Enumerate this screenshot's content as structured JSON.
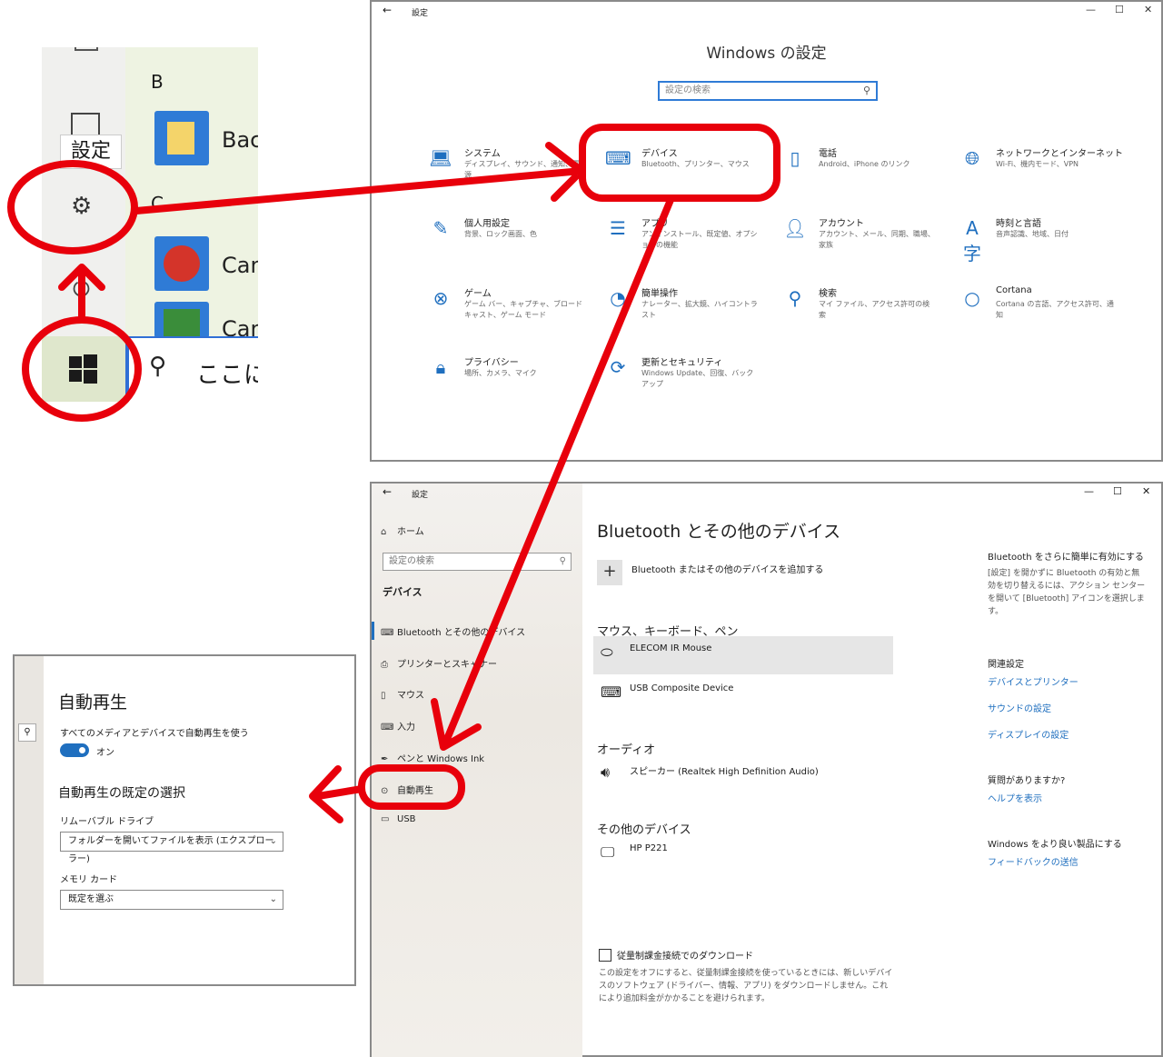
{
  "start_menu": {
    "letter_b": "B",
    "letter_c": "C",
    "tooltip": "設定",
    "apps": [
      "Bacl",
      "Can",
      "Can"
    ],
    "search_text": "ここに入"
  },
  "home_window": {
    "title_bar": "設定",
    "back": "←",
    "controls": [
      "—",
      "☐",
      "✕"
    ],
    "heading": "Windows の設定",
    "search_placeholder": "設定の検索",
    "categories": [
      {
        "name": "システム",
        "desc": "ディスプレイ、サウンド、通知、電源",
        "icon": "laptop-icon"
      },
      {
        "name": "デバイス",
        "desc": "Bluetooth、プリンター、マウス",
        "icon": "keyboard-speaker-icon"
      },
      {
        "name": "電話",
        "desc": "Android、iPhone のリンク",
        "icon": "phone-icon"
      },
      {
        "name": "ネットワークとインターネット",
        "desc": "Wi-Fi、機内モード、VPN",
        "icon": "globe-icon"
      },
      {
        "name": "個人用設定",
        "desc": "背景、ロック画面、色",
        "icon": "paint-icon"
      },
      {
        "name": "アプリ",
        "desc": "アンインストール、既定値、オプションの機能",
        "icon": "apps-list-icon"
      },
      {
        "name": "アカウント",
        "desc": "アカウント、メール、同期、職場、家族",
        "icon": "person-icon"
      },
      {
        "name": "時刻と言語",
        "desc": "音声認識、地域、日付",
        "icon": "time-language-icon"
      },
      {
        "name": "ゲーム",
        "desc": "ゲーム バー、キャプチャ、ブロードキャスト、ゲーム モード",
        "icon": "xbox-icon"
      },
      {
        "name": "簡単操作",
        "desc": "ナレーター、拡大鏡、ハイコントラスト",
        "icon": "ease-of-access-icon"
      },
      {
        "name": "検索",
        "desc": "マイ ファイル、アクセス許可の検索",
        "icon": "search-icon"
      },
      {
        "name": "Cortana",
        "desc": "Cortana の言語、アクセス許可、通知",
        "icon": "cortana-icon"
      },
      {
        "name": "プライバシー",
        "desc": "場所、カメラ、マイク",
        "icon": "lock-icon"
      },
      {
        "name": "更新とセキュリティ",
        "desc": "Windows Update、回復、バックアップ",
        "icon": "refresh-icon"
      }
    ]
  },
  "devices_window": {
    "title_bar": "設定",
    "back": "←",
    "controls": [
      "—",
      "☐",
      "✕"
    ],
    "sidebar": {
      "home": "ホーム",
      "search_placeholder": "設定の検索",
      "section": "デバイス",
      "items": [
        {
          "label": "Bluetooth とその他のデバイス",
          "icon": "bluetooth-devices-icon"
        },
        {
          "label": "プリンターとスキャナー",
          "icon": "printer-icon"
        },
        {
          "label": "マウス",
          "icon": "mouse-icon"
        },
        {
          "label": "入力",
          "icon": "keyboard-icon"
        },
        {
          "label": "ペンと Windows Ink",
          "icon": "pen-icon"
        },
        {
          "label": "自動再生",
          "icon": "autoplay-icon"
        },
        {
          "label": "USB",
          "icon": "usb-icon"
        }
      ]
    },
    "main": {
      "heading": "Bluetooth とその他のデバイス",
      "add_device": "Bluetooth またはその他のデバイスを追加する",
      "section_mouse": "マウス、キーボード、ペン",
      "mouse_devices": [
        "ELECOM IR Mouse",
        "USB Composite Device"
      ],
      "section_audio": "オーディオ",
      "audio_devices": [
        "スピーカー (Realtek High Definition Audio)"
      ],
      "section_other": "その他のデバイス",
      "other_devices": [
        "HP P221"
      ],
      "metered_label": "従量制課金接続でのダウンロード",
      "metered_desc": "この設定をオフにすると、従量制課金接続を使っているときには、新しいデバイスのソフトウェア (ドライバー、情報、アプリ) をダウンロードしません。これにより追加料金がかかることを避けられます。"
    },
    "right": {
      "tip_title": "Bluetooth をさらに簡単に有効にする",
      "tip_text": "[設定] を開かずに Bluetooth の有効と無効を切り替えるには、アクション センターを開いて [Bluetooth] アイコンを選択します。",
      "related_title": "関連設定",
      "related_links": [
        "デバイスとプリンター",
        "サウンドの設定",
        "ディスプレイの設定"
      ],
      "question_title": "質問がありますか?",
      "help_link": "ヘルプを表示",
      "improve_title": "Windows をより良い製品にする",
      "feedback_link": "フィードバックの送信"
    }
  },
  "autoplay_window": {
    "heading": "自動再生",
    "use_all": "すべてのメディアとデバイスで自動再生を使う",
    "toggle_state": "オン",
    "defaults_heading": "自動再生の既定の選択",
    "removable_label": "リムーバブル ドライブ",
    "removable_value": "フォルダーを開いてファイルを表示 (エクスプローラー)",
    "memory_label": "メモリ カード",
    "memory_value": "既定を選ぶ"
  },
  "colors": {
    "accent": "#1f6fbf",
    "annotation": "#e8000b"
  }
}
